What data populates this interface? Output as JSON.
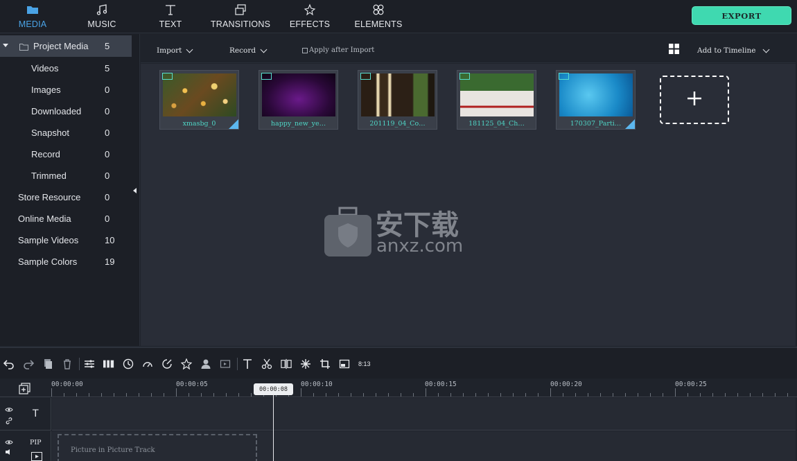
{
  "nav": {
    "tabs": [
      {
        "label": "MEDIA",
        "icon": "folder-icon",
        "active": true
      },
      {
        "label": "MUSIC",
        "icon": "music-note-icon"
      },
      {
        "label": "TEXT",
        "icon": "text-icon"
      },
      {
        "label": "TRANSITIONS",
        "icon": "transitions-icon"
      },
      {
        "label": "EFFECTS",
        "icon": "effects-icon"
      },
      {
        "label": "ELEMENTS",
        "icon": "elements-icon"
      }
    ],
    "export_label": "EXPORT"
  },
  "sidebar": {
    "items": [
      {
        "label": "Project Media",
        "count": "5"
      },
      {
        "label": "Videos",
        "count": "5"
      },
      {
        "label": "Images",
        "count": "0"
      },
      {
        "label": "Downloaded",
        "count": "0"
      },
      {
        "label": "Snapshot",
        "count": "0"
      },
      {
        "label": "Record",
        "count": "0"
      },
      {
        "label": "Trimmed",
        "count": "0"
      },
      {
        "label": "Store Resource",
        "count": "0"
      },
      {
        "label": "Online Media",
        "count": "0"
      },
      {
        "label": "Sample Videos",
        "count": "10"
      },
      {
        "label": "Sample Colors",
        "count": "19"
      }
    ]
  },
  "mediabar": {
    "import_label": "Import",
    "record_label": "Record",
    "apply_label": "Apply after Import",
    "add_to_timeline_label": "Add to Timeline"
  },
  "media": {
    "items": [
      {
        "name": "xmasbg_0"
      },
      {
        "name": "happy_new_ye…"
      },
      {
        "name": "201119_04_Co…"
      },
      {
        "name": "181125_04_Ch…"
      },
      {
        "name": "170307_Parti…"
      }
    ]
  },
  "watermark": {
    "cn": "安下载",
    "url": "anxz.com"
  },
  "timeline": {
    "zoom_label": "8:13",
    "ticks": [
      "00:00:00",
      "00:00:05",
      "00:00:10",
      "00:00:15",
      "00:00:20",
      "00:00:25"
    ],
    "playhead": "00:00:08",
    "pip_label": "PIP",
    "pip_placeholder": "Picture in Picture Track",
    "text_track_label": "T"
  },
  "colors": {
    "accent": "#4aa3e6",
    "export": "#3fd9b0",
    "panel": "#292d37"
  }
}
